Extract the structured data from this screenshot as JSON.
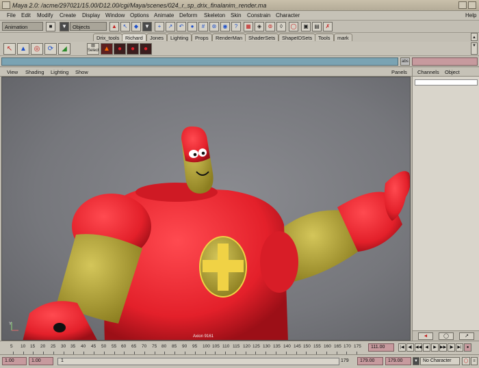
{
  "window": {
    "title": "Maya 2.0: /acme/297021/15.00/D12.00/cgi/Maya/scenes/024_r_sp_drix_finalanim_render.ma"
  },
  "menubar": {
    "items": [
      "File",
      "Edit",
      "Modify",
      "Create",
      "Display",
      "Window",
      "Options",
      "Animate",
      "Deform",
      "Skeleton",
      "Skin",
      "Constrain",
      "Character"
    ],
    "help": "Help"
  },
  "toolbar": {
    "mode": "Animation",
    "selection_mask": "Objects"
  },
  "shelf": {
    "tabs": [
      "Drix_tools",
      "Richard",
      "Jones",
      "Lighting",
      "Props",
      "RenderMan",
      "ShaderSets",
      "ShapeIDSets",
      "Tools",
      "mark"
    ],
    "active_tab": "Richard",
    "select_label": "Select"
  },
  "commandline": {
    "abs_label": "abs"
  },
  "panel": {
    "menus": [
      "View",
      "Shading",
      "Lighting",
      "Show"
    ],
    "panels_label": "Panels"
  },
  "viewport": {
    "label": "Axion 9161",
    "axis_label": "Y"
  },
  "channelbox": {
    "menus": [
      "Channels",
      "Object"
    ]
  },
  "timeline": {
    "ticks": [
      "5",
      "10",
      "15",
      "20",
      "25",
      "30",
      "35",
      "40",
      "45",
      "50",
      "55",
      "60",
      "65",
      "70",
      "75",
      "80",
      "85",
      "90",
      "95",
      "100",
      "105",
      "110",
      "115",
      "120",
      "125",
      "130",
      "135",
      "140",
      "145",
      "150",
      "155",
      "160",
      "165",
      "170",
      "175"
    ],
    "current_frame": "111.00"
  },
  "range": {
    "start": "1.00",
    "playback_start": "1.00",
    "range_start_num": "1",
    "range_end_num": "179",
    "playback_end": "179.00",
    "end": "179.00",
    "character": "No Character"
  },
  "colors": {
    "character_red": "#e3202a",
    "character_yellow": "#b7a73a",
    "viewport_bg": "#7d7e83",
    "command_line": "#7aa3b3",
    "result_field": "#c79a9e"
  }
}
